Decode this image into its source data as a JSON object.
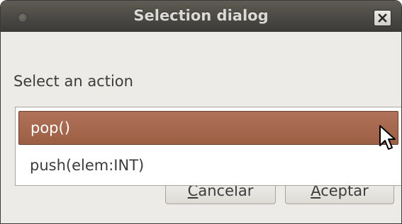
{
  "window": {
    "title": "Selection dialog",
    "close_icon": "close-icon"
  },
  "dialog": {
    "prompt": "Select an action",
    "actions": [
      {
        "label": "pop()",
        "selected": true
      },
      {
        "label": "push(elem:INT)",
        "selected": false
      }
    ],
    "buttons": {
      "cancel": {
        "mnemonic": "C",
        "rest": "ancelar"
      },
      "accept": {
        "mnemonic": "A",
        "rest": "ceptar"
      }
    }
  },
  "colors": {
    "titlebar": "#4b4944",
    "selection": "#a66a50",
    "window_bg": "#edebe8"
  }
}
